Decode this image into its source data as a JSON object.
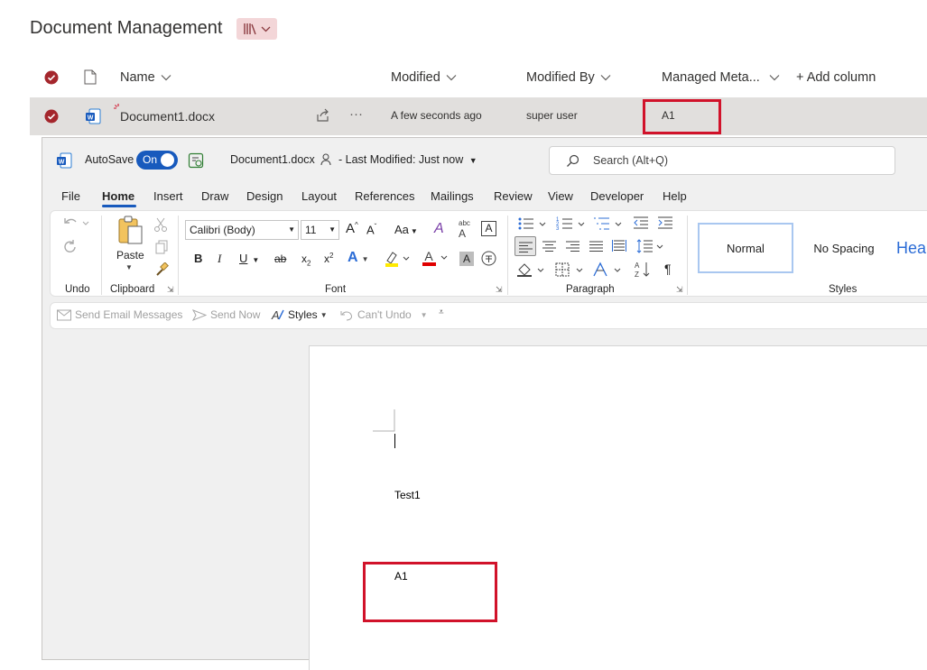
{
  "sharepoint": {
    "title": "Document Management",
    "columns": {
      "name": "Name",
      "modified": "Modified",
      "modified_by": "Modified By",
      "managed_meta": "Managed Meta...",
      "add_column": "+ Add column"
    },
    "row": {
      "name": "Document1.docx",
      "more": "···",
      "modified": "A few seconds ago",
      "modified_by": "super user",
      "managed_meta": "A1"
    }
  },
  "word": {
    "autosave_label": "AutoSave",
    "autosave_state": "On",
    "filename": "Document1.docx",
    "last_modified": "- Last Modified: Just now",
    "search_placeholder": "Search (Alt+Q)",
    "menu": [
      "File",
      "Home",
      "Insert",
      "Draw",
      "Design",
      "Layout",
      "References",
      "Mailings",
      "Review",
      "View",
      "Developer",
      "Help"
    ],
    "ribbon": {
      "paste": "Paste",
      "font_name": "Calibri (Body)",
      "font_size": "11",
      "groups": {
        "undo": "Undo",
        "clipboard": "Clipboard",
        "font": "Font",
        "paragraph": "Paragraph",
        "styles": "Styles"
      },
      "styles": [
        "Normal",
        "No Spacing",
        "Hea"
      ]
    },
    "qat": {
      "send_email": "Send Email Messages",
      "send_now": "Send Now",
      "styles": "Styles",
      "cant_undo": "Can't Undo"
    },
    "document": {
      "line1": "Test1",
      "line2": "A1"
    }
  },
  "colors": {
    "brand_blue": "#185abd",
    "highlight_red": "#d1122a",
    "check_red": "#a4262c"
  }
}
